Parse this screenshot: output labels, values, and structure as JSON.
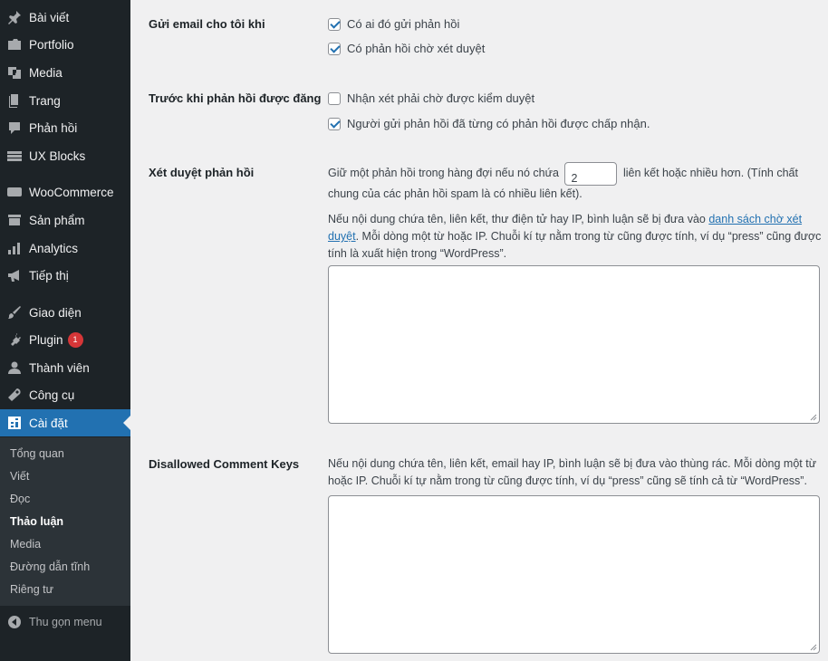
{
  "sidebar": {
    "items": [
      {
        "label": "Bài viết",
        "icon": "pin-icon"
      },
      {
        "label": "Portfolio",
        "icon": "folder-icon"
      },
      {
        "label": "Media",
        "icon": "media-icon"
      },
      {
        "label": "Trang",
        "icon": "page-icon"
      },
      {
        "label": "Phản hồi",
        "icon": "comment-icon"
      },
      {
        "label": "UX Blocks",
        "icon": "blocks-icon"
      },
      {
        "label": "WooCommerce",
        "icon": "woo-icon"
      },
      {
        "label": "Sản phẩm",
        "icon": "archive-icon"
      },
      {
        "label": "Analytics",
        "icon": "chart-bar-icon"
      },
      {
        "label": "Tiếp thị",
        "icon": "megaphone-icon"
      },
      {
        "label": "Giao diện",
        "icon": "brush-icon"
      },
      {
        "label": "Plugin",
        "icon": "plug-icon",
        "badge": "1"
      },
      {
        "label": "Thành viên",
        "icon": "user-icon"
      },
      {
        "label": "Công cụ",
        "icon": "wrench-icon"
      },
      {
        "label": "Cài đặt",
        "icon": "settings-icon",
        "active": true
      }
    ],
    "submenu": [
      {
        "label": "Tổng quan"
      },
      {
        "label": "Viết"
      },
      {
        "label": "Đọc"
      },
      {
        "label": "Thảo luận",
        "current": true
      },
      {
        "label": "Media"
      },
      {
        "label": "Đường dẫn tĩnh"
      },
      {
        "label": "Riêng tư"
      }
    ],
    "collapse_label": "Thu gọn menu"
  },
  "settings": {
    "email_me": {
      "label": "Gửi email cho tôi khi",
      "options": [
        {
          "label": "Có ai đó gửi phản hồi",
          "checked": true
        },
        {
          "label": "Có phản hồi chờ xét duyệt",
          "checked": true
        }
      ]
    },
    "before_appear": {
      "label": "Trước khi phản hồi được đăng",
      "options": [
        {
          "label": "Nhận xét phải chờ được kiểm duyệt",
          "checked": false
        },
        {
          "label": "Người gửi phản hồi đã từng có phản hồi được chấp nhận.",
          "checked": true
        }
      ]
    },
    "moderation": {
      "label": "Xét duyệt phản hồi",
      "text_before": "Giữ một phản hồi trong hàng đợi nếu nó chứa",
      "links_value": "2",
      "text_after": "liên kết hoặc nhiều hơn. (Tính chất",
      "text_line2": "chung của các phản hồi spam là có nhiều liên kết).",
      "keys_desc_1": "Nếu nội dung chứa tên, liên kết, thư điện tử hay IP, bình luận sẽ bị đưa vào",
      "keys_link": "danh sách chờ xét duyệt",
      "keys_desc_2": ". Mỗi dòng một từ hoặc IP. Chuỗi kí tự nằm trong từ cũng được tính, ví dụ “press” cũng được tính là xuất hiện trong “WordPress”.",
      "textarea_value": ""
    },
    "disallowed": {
      "label": "Disallowed Comment Keys",
      "desc": "Nếu nội dung chứa tên, liên kết, email hay IP, bình luận sẽ bị đưa vào thùng rác. Mỗi dòng một từ hoặc IP. Chuỗi kí tự nằm trong từ cũng được tính, ví dụ “press” cũng sẽ tính cả từ “WordPress”.",
      "textarea_value": ""
    }
  },
  "colors": {
    "sidebar_bg": "#1d2327",
    "submenu_bg": "#2c3338",
    "accent": "#2271b1",
    "badge": "#d63638",
    "page_bg": "#f0f0f1"
  }
}
